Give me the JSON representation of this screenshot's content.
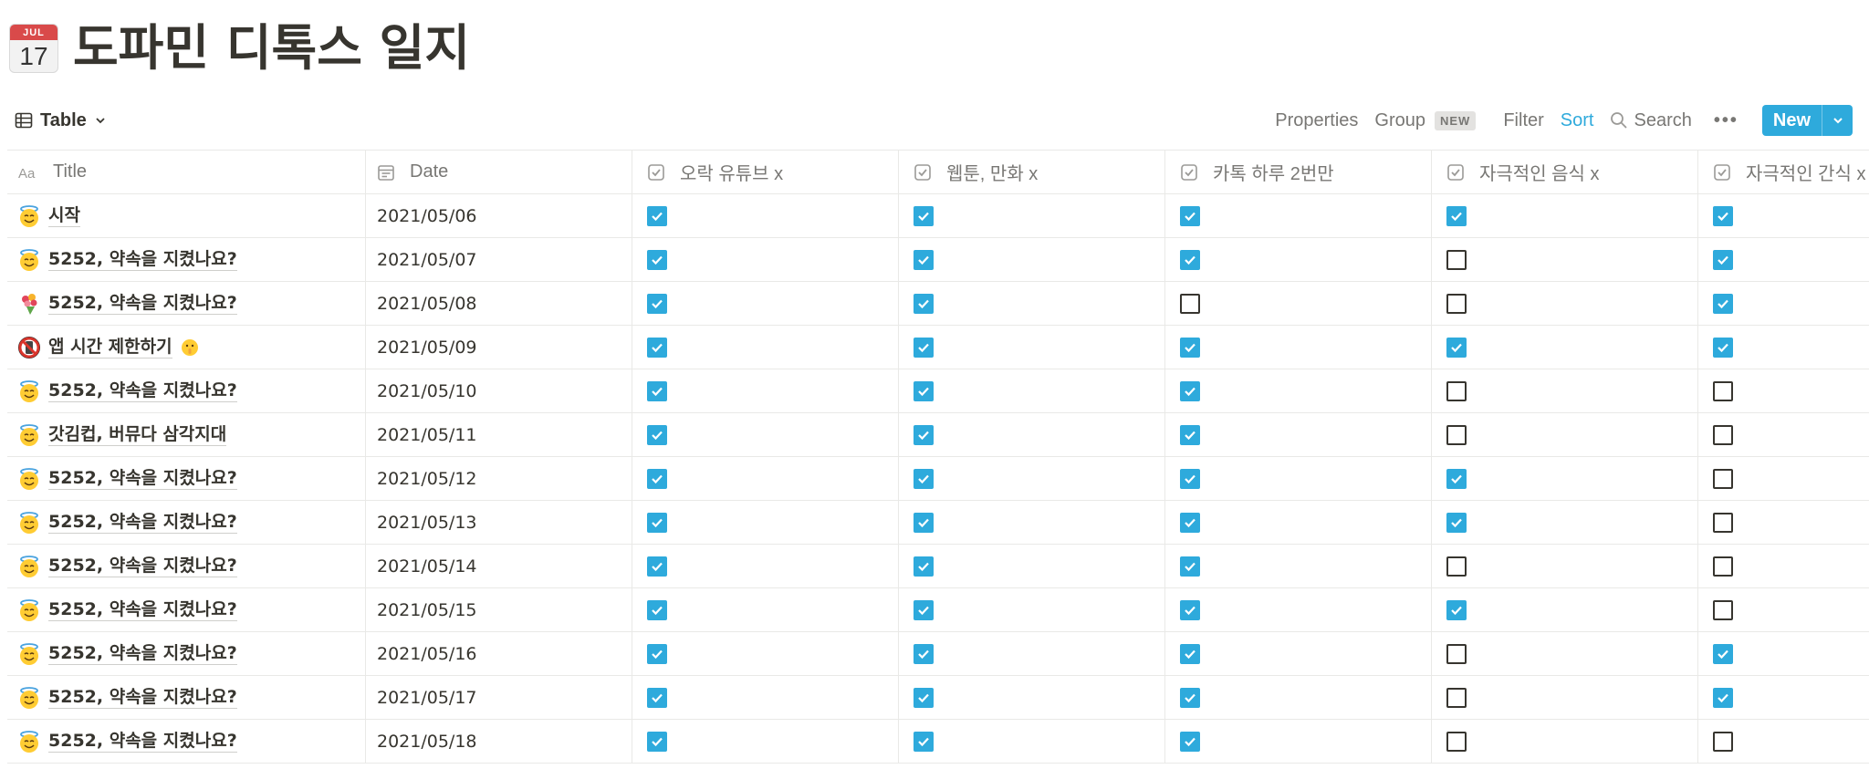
{
  "page": {
    "icon": "calendar-icon",
    "icon_month": "JUL",
    "icon_day": "17",
    "title": "도파민 디톡스 일지"
  },
  "view": {
    "icon": "table-icon",
    "label": "Table"
  },
  "toolbar": {
    "properties": "Properties",
    "group": "Group",
    "group_badge": "NEW",
    "filter": "Filter",
    "sort": "Sort",
    "search": "Search",
    "more": "•••",
    "new": "New",
    "accent_color": "#2eaadc"
  },
  "columns": [
    {
      "key": "title",
      "label": "Title",
      "icon": "text-aa-icon"
    },
    {
      "key": "date",
      "label": "Date",
      "icon": "calendar-date-icon"
    },
    {
      "key": "c1",
      "label": "오락 유튜브 x",
      "icon": "checkbox-property-icon"
    },
    {
      "key": "c2",
      "label": "웹툰, 만화 x",
      "icon": "checkbox-property-icon"
    },
    {
      "key": "c3",
      "label": "카톡 하루 2번만",
      "icon": "checkbox-property-icon"
    },
    {
      "key": "c4",
      "label": "자극적인 음식 x",
      "icon": "checkbox-property-icon"
    },
    {
      "key": "c5",
      "label": "자극적인 간식 x",
      "icon": "checkbox-property-icon"
    }
  ],
  "rows": [
    {
      "emoji": "smiling-halo-face-icon",
      "title": "시작",
      "date": "2021/05/06",
      "checks": [
        true,
        true,
        true,
        true,
        true
      ]
    },
    {
      "emoji": "smiling-halo-face-icon",
      "title": "5252, 약속을 지켰나요?",
      "date": "2021/05/07",
      "checks": [
        true,
        true,
        true,
        false,
        true
      ]
    },
    {
      "emoji": "bouquet-icon",
      "title": "5252, 약속을 지켰나요?",
      "date": "2021/05/08",
      "checks": [
        true,
        true,
        false,
        false,
        true
      ]
    },
    {
      "emoji": "no-mobile-phones-icon",
      "title": "앱 시간 제한하기",
      "title_suffix_emoji": "shushing-face-icon",
      "date": "2021/05/09",
      "checks": [
        true,
        true,
        true,
        true,
        true
      ]
    },
    {
      "emoji": "smiling-halo-face-icon",
      "title": "5252, 약속을 지켰나요?",
      "date": "2021/05/10",
      "checks": [
        true,
        true,
        true,
        false,
        false
      ]
    },
    {
      "emoji": "smiling-halo-face-icon",
      "title": "갓김컵, 버뮤다 삼각지대",
      "date": "2021/05/11",
      "checks": [
        true,
        true,
        true,
        false,
        false
      ]
    },
    {
      "emoji": "smiling-halo-face-icon",
      "title": "5252, 약속을 지켰나요?",
      "date": "2021/05/12",
      "checks": [
        true,
        true,
        true,
        true,
        false
      ]
    },
    {
      "emoji": "smiling-halo-face-icon",
      "title": "5252, 약속을 지켰나요?",
      "date": "2021/05/13",
      "checks": [
        true,
        true,
        true,
        true,
        false
      ]
    },
    {
      "emoji": "smiling-halo-face-icon",
      "title": "5252, 약속을 지켰나요?",
      "date": "2021/05/14",
      "checks": [
        true,
        true,
        true,
        false,
        false
      ]
    },
    {
      "emoji": "smiling-halo-face-icon",
      "title": "5252, 약속을 지켰나요?",
      "date": "2021/05/15",
      "checks": [
        true,
        true,
        true,
        true,
        false
      ]
    },
    {
      "emoji": "smiling-halo-face-icon",
      "title": "5252, 약속을 지켰나요?",
      "date": "2021/05/16",
      "checks": [
        true,
        true,
        true,
        false,
        true
      ]
    },
    {
      "emoji": "smiling-halo-face-icon",
      "title": "5252, 약속을 지켰나요?",
      "date": "2021/05/17",
      "checks": [
        true,
        true,
        true,
        false,
        true
      ]
    },
    {
      "emoji": "smiling-halo-face-icon",
      "title": "5252, 약속을 지켰나요?",
      "date": "2021/05/18",
      "checks": [
        true,
        true,
        true,
        false,
        false
      ]
    }
  ]
}
